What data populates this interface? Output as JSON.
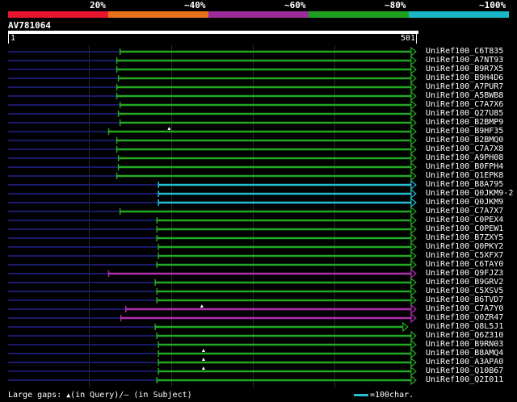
{
  "header": {
    "percent_labels": [
      "20%",
      "~40%",
      "~60%",
      "~80%",
      "~100%"
    ],
    "band_colors": [
      "#e8152e",
      "#e8721a",
      "#9b2d9b",
      "#1ea01e",
      "#18b6c6"
    ]
  },
  "query": {
    "id": "AV781064",
    "start_label": "1",
    "end_label": "501",
    "length": 501
  },
  "colors": {
    "green": "#22aa22",
    "cyan": "#22c0d0",
    "purple": "#b030b0",
    "leading": "#1a1a6a",
    "gap": "#ffffff"
  },
  "hits": [
    {
      "id": "UniRef100_C6T835",
      "start": 138,
      "end": 494,
      "color": "green",
      "gap": null
    },
    {
      "id": "UniRef100_A7NT93",
      "start": 134,
      "end": 494,
      "color": "green",
      "gap": null
    },
    {
      "id": "UniRef100_B9R7X5",
      "start": 134,
      "end": 494,
      "color": "green",
      "gap": null
    },
    {
      "id": "UniRef100_B9H4D6",
      "start": 136,
      "end": 494,
      "color": "green",
      "gap": null
    },
    {
      "id": "UniRef100_A7PUR7",
      "start": 134,
      "end": 494,
      "color": "green",
      "gap": null
    },
    {
      "id": "UniRef100_A5BWB8",
      "start": 134,
      "end": 494,
      "color": "green",
      "gap": null
    },
    {
      "id": "UniRef100_C7A7X6",
      "start": 138,
      "end": 494,
      "color": "green",
      "gap": null
    },
    {
      "id": "UniRef100_Q27U85",
      "start": 136,
      "end": 494,
      "color": "green",
      "gap": null
    },
    {
      "id": "UniRef100_B2BMP9",
      "start": 138,
      "end": 494,
      "color": "green",
      "gap": null
    },
    {
      "id": "UniRef100_B9HF35",
      "start": 124,
      "end": 494,
      "color": "green",
      "gap": 198
    },
    {
      "id": "UniRef100_B2BMQ0",
      "start": 134,
      "end": 494,
      "color": "green",
      "gap": null
    },
    {
      "id": "UniRef100_C7A7X8",
      "start": 134,
      "end": 494,
      "color": "green",
      "gap": null
    },
    {
      "id": "UniRef100_A9PH08",
      "start": 136,
      "end": 494,
      "color": "green",
      "gap": null
    },
    {
      "id": "UniRef100_B0FPH4",
      "start": 136,
      "end": 494,
      "color": "green",
      "gap": null
    },
    {
      "id": "UniRef100_Q1EPK8",
      "start": 134,
      "end": 494,
      "color": "green",
      "gap": null
    },
    {
      "id": "UniRef100_B8A795",
      "start": 185,
      "end": 494,
      "color": "cyan",
      "gap": null
    },
    {
      "id": "UniRef100_Q0JKM9-2",
      "start": 185,
      "end": 494,
      "color": "cyan",
      "gap": null
    },
    {
      "id": "UniRef100_Q0JKM9",
      "start": 185,
      "end": 494,
      "color": "cyan",
      "gap": null
    },
    {
      "id": "UniRef100_C7A7X7",
      "start": 138,
      "end": 494,
      "color": "green",
      "gap": null
    },
    {
      "id": "UniRef100_C0PEX4",
      "start": 183,
      "end": 494,
      "color": "green",
      "gap": null
    },
    {
      "id": "UniRef100_C0PEW1",
      "start": 183,
      "end": 494,
      "color": "green",
      "gap": null
    },
    {
      "id": "UniRef100_B7ZXY5",
      "start": 183,
      "end": 494,
      "color": "green",
      "gap": null
    },
    {
      "id": "UniRef100_Q0PKY2",
      "start": 185,
      "end": 494,
      "color": "green",
      "gap": null
    },
    {
      "id": "UniRef100_C5XFX7",
      "start": 185,
      "end": 494,
      "color": "green",
      "gap": null
    },
    {
      "id": "UniRef100_C6TAY0",
      "start": 183,
      "end": 494,
      "color": "green",
      "gap": null
    },
    {
      "id": "UniRef100_Q9FJZ3",
      "start": 124,
      "end": 494,
      "color": "purple",
      "gap": null
    },
    {
      "id": "UniRef100_B9GRV2",
      "start": 181,
      "end": 494,
      "color": "green",
      "gap": null
    },
    {
      "id": "UniRef100_C5XSV5",
      "start": 183,
      "end": 494,
      "color": "green",
      "gap": null
    },
    {
      "id": "UniRef100_B6TVD7",
      "start": 183,
      "end": 494,
      "color": "green",
      "gap": null
    },
    {
      "id": "UniRef100_C7A7Y0",
      "start": 145,
      "end": 494,
      "color": "purple",
      "gap": 238
    },
    {
      "id": "UniRef100_Q0ZR47",
      "start": 139,
      "end": 494,
      "color": "purple",
      "gap": null
    },
    {
      "id": "UniRef100_Q8L5J1",
      "start": 181,
      "end": 484,
      "color": "green",
      "gap": null
    },
    {
      "id": "UniRef100_Q6Z310",
      "start": 183,
      "end": 494,
      "color": "green",
      "gap": null
    },
    {
      "id": "UniRef100_B9RN03",
      "start": 185,
      "end": 494,
      "color": "green",
      "gap": null
    },
    {
      "id": "UniRef100_B8AMQ4",
      "start": 185,
      "end": 494,
      "color": "green",
      "gap": 240
    },
    {
      "id": "UniRef100_A3APA0",
      "start": 185,
      "end": 494,
      "color": "green",
      "gap": 240
    },
    {
      "id": "UniRef100_Q10B67",
      "start": 185,
      "end": 494,
      "color": "green",
      "gap": 240
    },
    {
      "id": "UniRef100_Q2I011",
      "start": 183,
      "end": 494,
      "color": "green",
      "gap": null
    }
  ],
  "footer": {
    "gaps_prefix": "Large gaps:",
    "gaps_marker": "▲",
    "gaps_in_query": "(in Query)/",
    "gaps_dash": "–",
    "gaps_in_subject": "(in Subject)",
    "scale_label": "=100char."
  }
}
